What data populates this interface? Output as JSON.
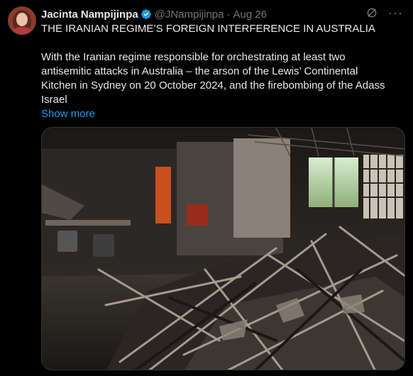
{
  "author": {
    "name": "Jacinta Nampijinpa",
    "handle": "@JNampijinpa",
    "date": "Aug 26",
    "verified": true
  },
  "tweet": {
    "title": "THE IRANIAN REGIME’S FOREIGN INTERFERENCE IN AUSTRALIA",
    "body_lines": [
      "With the Iranian regime responsible for orchestrating at least two",
      "antisemitic attacks in Australia – the arson of the Lewis’ Continental",
      "Kitchen in Sydney on 20 October 2024, and the firebombing of the Adass",
      "Israel"
    ],
    "show_more": "Show more"
  },
  "icons": {
    "verified": "verified-badge-icon",
    "grok": "grok-icon",
    "more": "more-options-icon"
  },
  "colors": {
    "background": "#000000",
    "text": "#e7e9ea",
    "secondary": "#71767b",
    "link": "#1d9bf0",
    "verified": "#1d9bf0"
  },
  "media": {
    "description_icon": "photo-burned-interior"
  }
}
